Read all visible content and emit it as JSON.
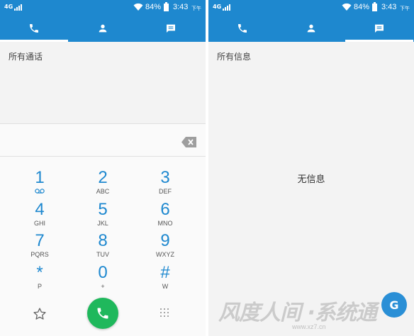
{
  "status_bar": {
    "network": "4G",
    "battery": "84%",
    "time": "3:43",
    "ampm": "下午"
  },
  "left_screen": {
    "tabs": [
      {
        "icon": "phone-icon",
        "active": true
      },
      {
        "icon": "contacts-icon",
        "active": false
      },
      {
        "icon": "messages-icon",
        "active": false
      }
    ],
    "section_title": "所有通话",
    "dialer": {
      "number_value": "",
      "keys": [
        {
          "digit": "1",
          "letters": "",
          "icon": "voicemail-icon"
        },
        {
          "digit": "2",
          "letters": "ABC"
        },
        {
          "digit": "3",
          "letters": "DEF"
        },
        {
          "digit": "4",
          "letters": "GHI"
        },
        {
          "digit": "5",
          "letters": "JKL"
        },
        {
          "digit": "6",
          "letters": "MNO"
        },
        {
          "digit": "7",
          "letters": "PQRS"
        },
        {
          "digit": "8",
          "letters": "TUV"
        },
        {
          "digit": "9",
          "letters": "WXYZ"
        },
        {
          "digit": "*",
          "letters": "P"
        },
        {
          "digit": "0",
          "letters": "+"
        },
        {
          "digit": "#",
          "letters": "W"
        }
      ]
    }
  },
  "right_screen": {
    "tabs": [
      {
        "icon": "phone-icon",
        "active": false
      },
      {
        "icon": "contacts-icon",
        "active": false
      },
      {
        "icon": "messages-icon",
        "active": true
      }
    ],
    "section_title": "所有信息",
    "empty_message": "无信息"
  },
  "watermark": {
    "text": "风度人间  ·系统通",
    "url": "www.xz7.cn",
    "badge": "G"
  },
  "colors": {
    "header_blue": "#1e88cf",
    "digit_blue": "#1e88cf",
    "call_green": "#1fb85c"
  }
}
